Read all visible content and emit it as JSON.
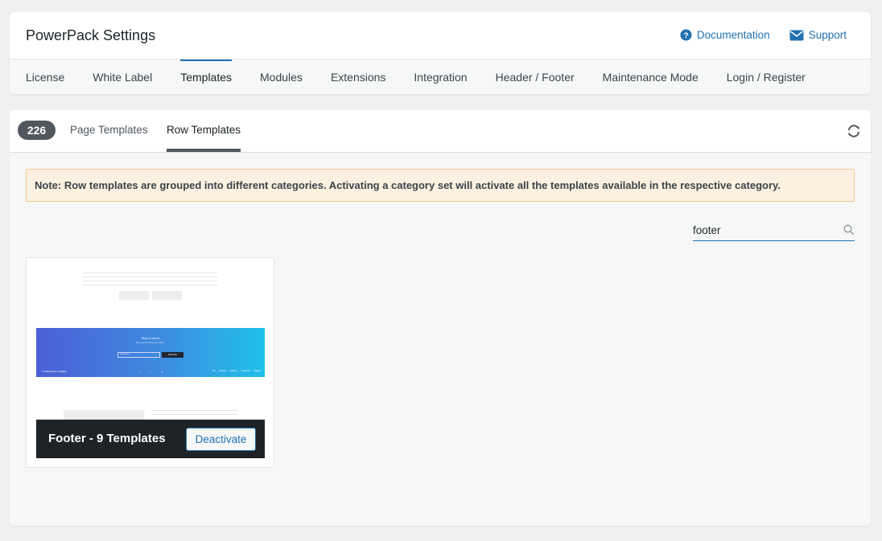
{
  "header": {
    "title": "PowerPack Settings",
    "links": [
      {
        "label": "Documentation",
        "icon": "question-circle-icon"
      },
      {
        "label": "Support",
        "icon": "envelope-icon"
      }
    ]
  },
  "nav": {
    "tabs": [
      {
        "label": "License",
        "active": false
      },
      {
        "label": "White Label",
        "active": false
      },
      {
        "label": "Templates",
        "active": true
      },
      {
        "label": "Modules",
        "active": false
      },
      {
        "label": "Extensions",
        "active": false
      },
      {
        "label": "Integration",
        "active": false
      },
      {
        "label": "Header / Footer",
        "active": false
      },
      {
        "label": "Maintenance Mode",
        "active": false
      },
      {
        "label": "Login / Register",
        "active": false
      }
    ]
  },
  "templates": {
    "count": "226",
    "sub_tabs": [
      {
        "label": "Page Templates",
        "active": false
      },
      {
        "label": "Row Templates",
        "active": true
      }
    ],
    "note": "Note: Row templates are grouped into different categories. Activating a category set will activate all the templates available in the respective category.",
    "search": {
      "value": "footer"
    },
    "cards": [
      {
        "title": "Footer - 9 Templates",
        "button_label": "Deactivate",
        "preview": {
          "banner_title": "Stay in touch",
          "banner_subtitle": "Some text to inform your visitors",
          "input_placeholder": "Email Address",
          "subscribe_label": "Subscribe",
          "copyright": "© 2018 Business. All Rights",
          "footer_links": "My Account Delivery Customer Support"
        }
      }
    ]
  },
  "colors": {
    "accent": "#2271b1",
    "badge_bg": "#50575e",
    "note_bg": "#fcf0e0",
    "overlay_bg": "#1d2327"
  }
}
